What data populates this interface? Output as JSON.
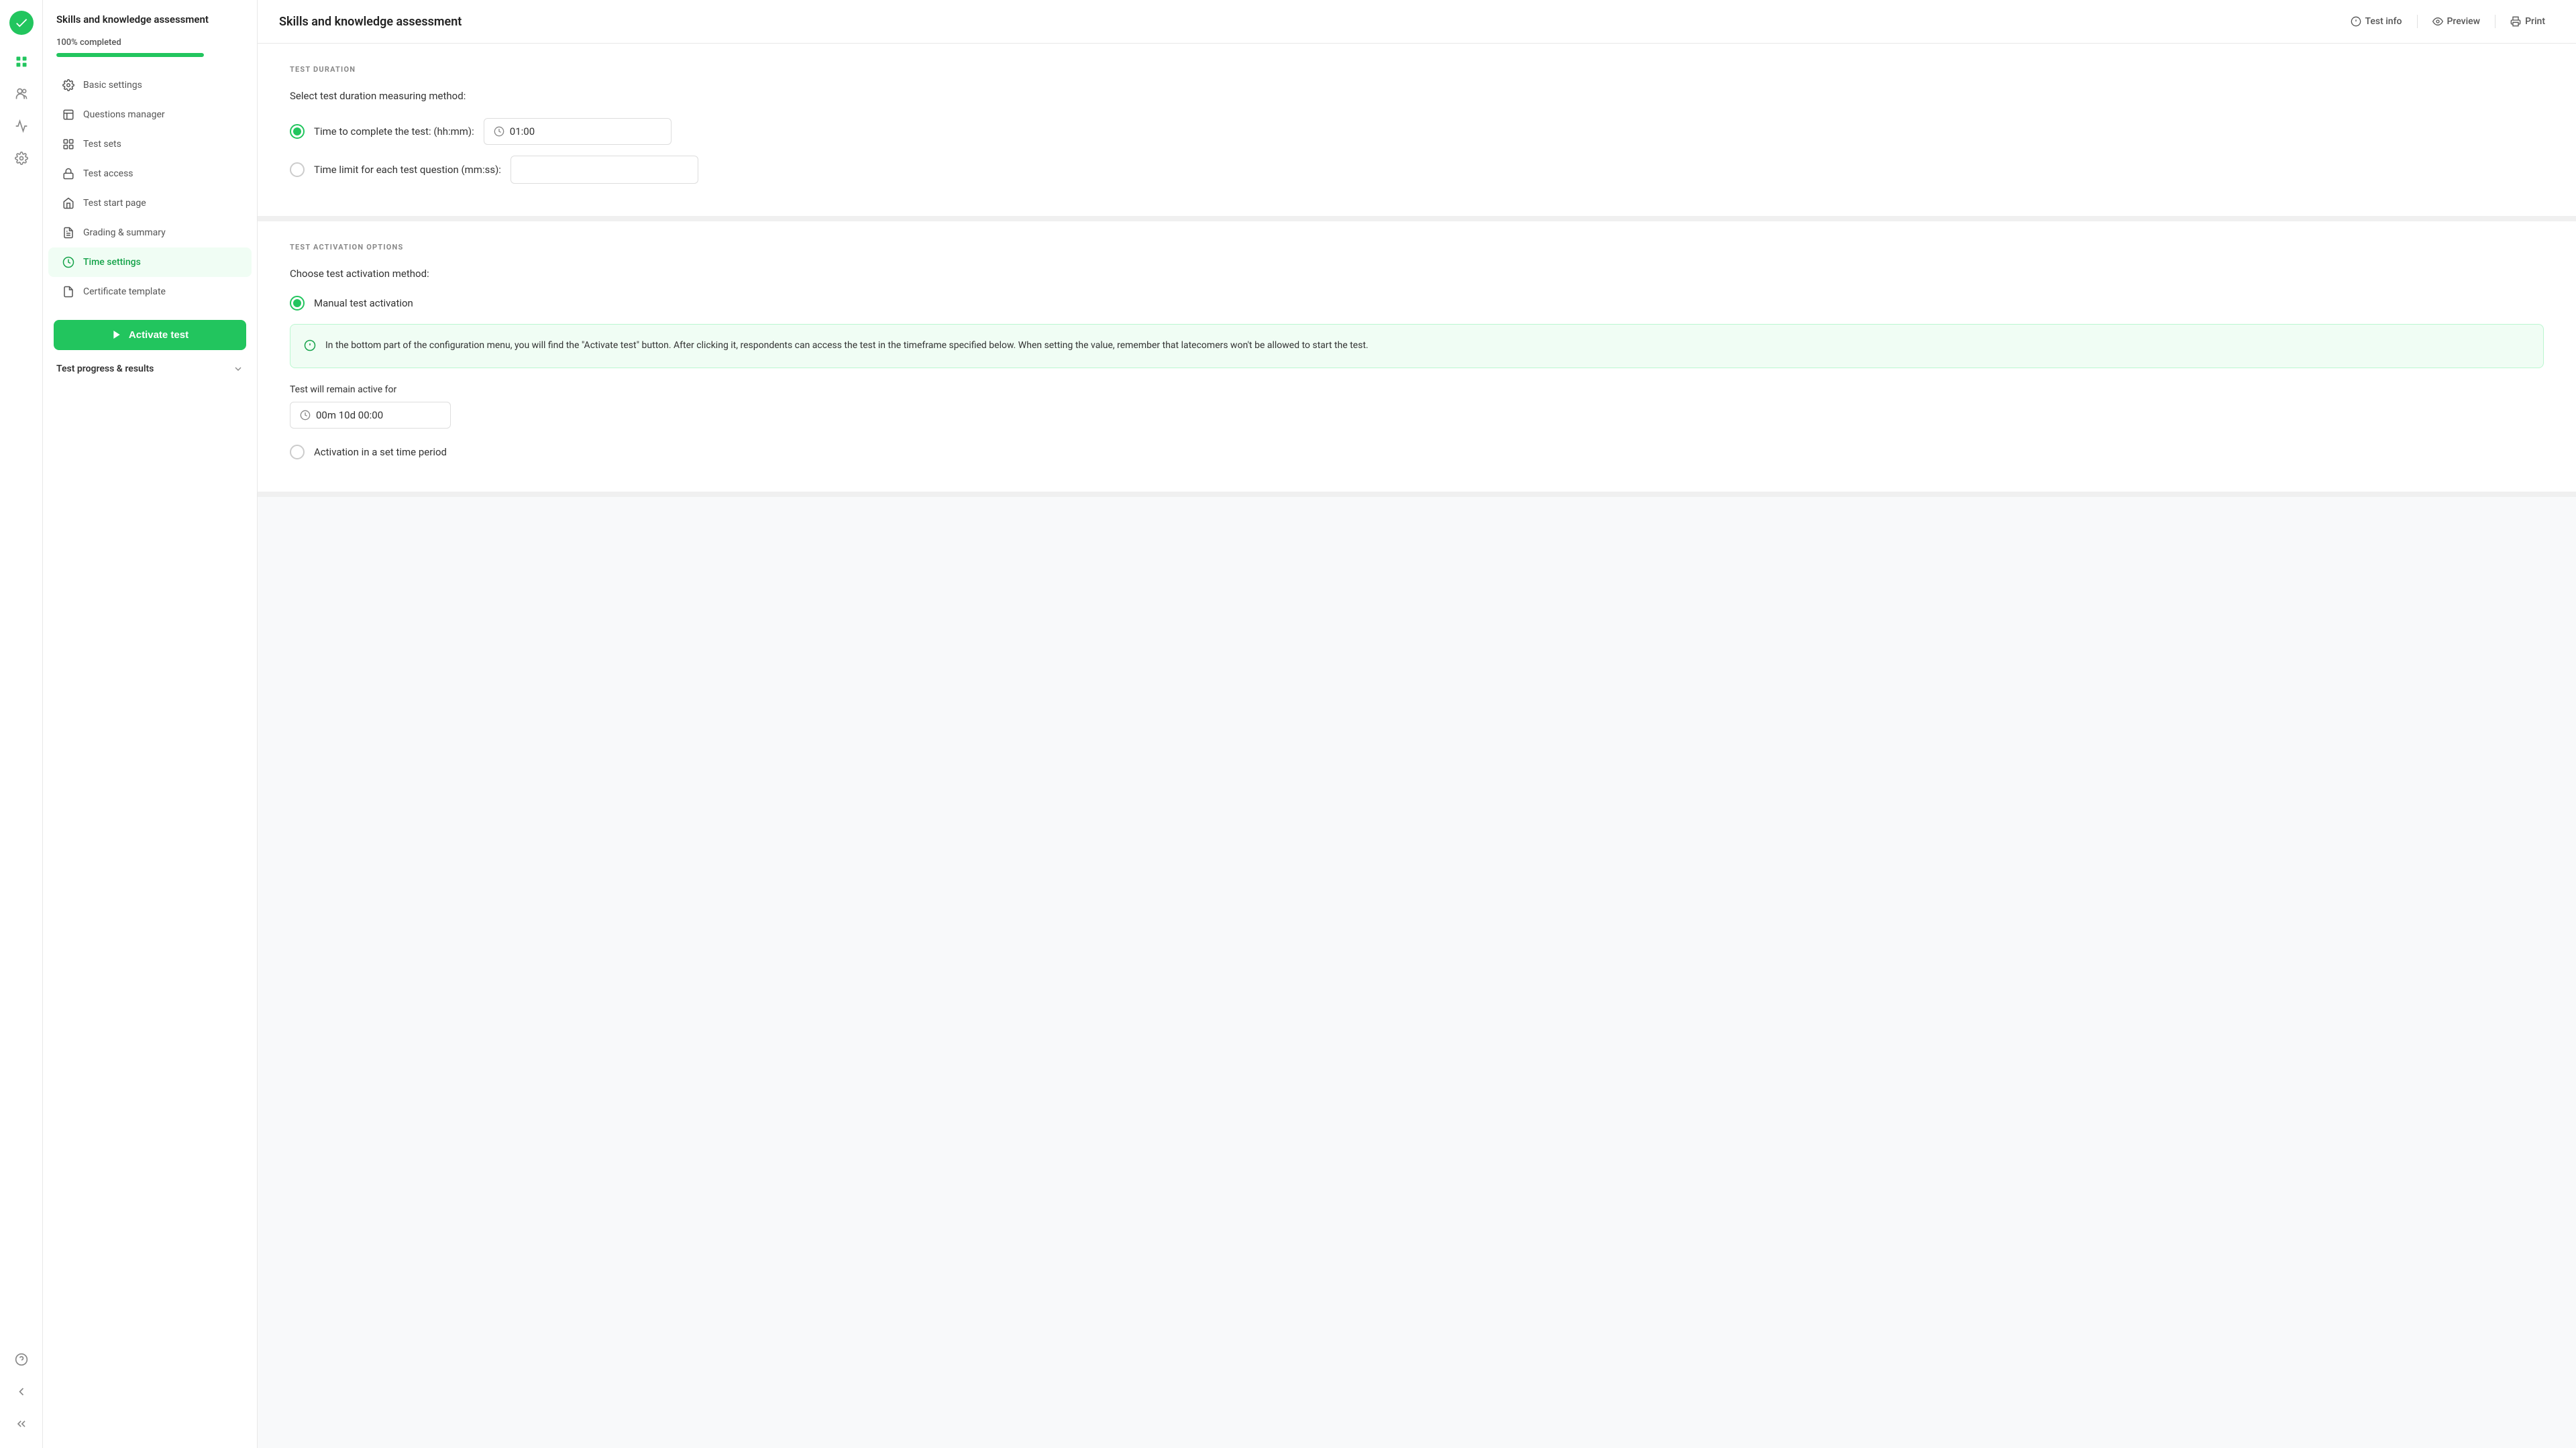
{
  "app": {
    "title": "Skills and knowledge assessment"
  },
  "topbar": {
    "title": "Skills and knowledge assessment",
    "test_info": "Test info",
    "preview": "Preview",
    "print": "Print"
  },
  "sidebar": {
    "progress_label": "100% completed",
    "nav_items": [
      {
        "id": "basic-settings",
        "label": "Basic settings",
        "icon": "settings"
      },
      {
        "id": "questions-manager",
        "label": "Questions manager",
        "icon": "questions"
      },
      {
        "id": "test-sets",
        "label": "Test sets",
        "icon": "sets"
      },
      {
        "id": "test-access",
        "label": "Test access",
        "icon": "lock"
      },
      {
        "id": "test-start-page",
        "label": "Test start page",
        "icon": "home"
      },
      {
        "id": "grading-summary",
        "label": "Grading & summary",
        "icon": "grading"
      },
      {
        "id": "time-settings",
        "label": "Time settings",
        "icon": "clock",
        "active": true
      },
      {
        "id": "certificate-template",
        "label": "Certificate template",
        "icon": "certificate"
      }
    ],
    "activate_button": "Activate test",
    "section_header": "Test progress & results"
  },
  "test_duration": {
    "section_title": "TEST DURATION",
    "description": "Select test duration measuring method:",
    "option1_label": "Time to complete the test: (hh:mm):",
    "option1_value": "01:00",
    "option2_label": "Time limit for each test question (mm:ss):"
  },
  "test_activation": {
    "section_title": "TEST ACTIVATION OPTIONS",
    "description": "Choose test activation method:",
    "option1_label": "Manual test activation",
    "info_text": "In the bottom part of the configuration menu, you will find the \"Activate test\" button. After clicking it, respondents can access the test in the timeframe specified below. When setting the value, remember that latecomers won't be allowed to start the test.",
    "active_for_label": "Test will remain active for",
    "active_for_value": "00m 10d 00:00",
    "option2_label": "Activation in a set time period"
  }
}
